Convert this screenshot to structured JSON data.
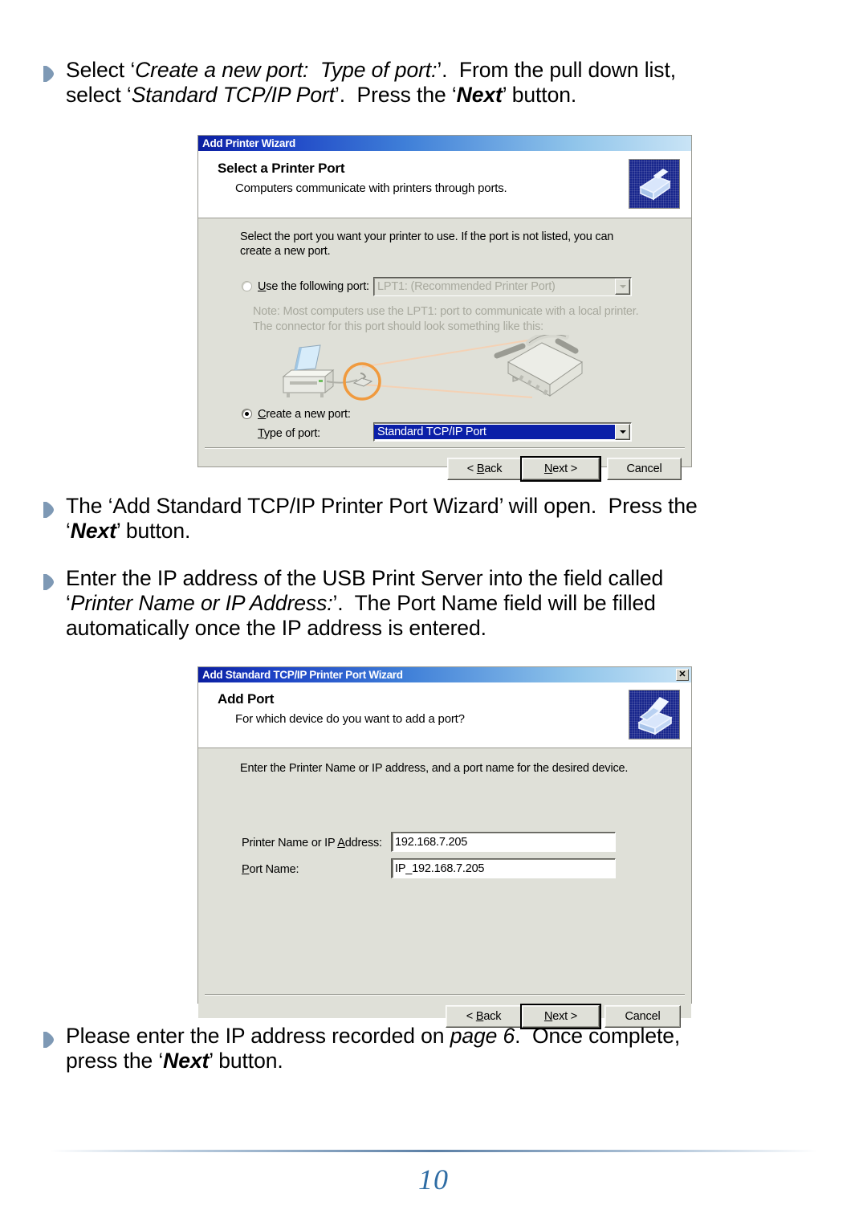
{
  "page": {
    "number": "10"
  },
  "instructions": [
    {
      "id": "step-select-create-new-port",
      "parts": [
        {
          "t": "Select ‘",
          "s": "n"
        },
        {
          "t": "Create a new port:  Type of port:",
          "s": "i"
        },
        {
          "t": "’.  From the pull down list, select ‘",
          "s": "n"
        },
        {
          "t": "Standard TCP/IP Port",
          "s": "i"
        },
        {
          "t": "’.  Press the ‘",
          "s": "n"
        },
        {
          "t": "Next",
          "s": "bi"
        },
        {
          "t": "’ button.",
          "s": "n"
        }
      ]
    },
    {
      "id": "step-wizard-opens",
      "parts": [
        {
          "t": "The ‘Add Standard TCP/IP Printer Port Wizard’ will open.  Press the ‘",
          "s": "n"
        },
        {
          "t": "Next",
          "s": "bi"
        },
        {
          "t": "’ button.",
          "s": "n"
        }
      ]
    },
    {
      "id": "step-enter-ip-address",
      "parts": [
        {
          "t": "Enter the IP address of the USB Print Server into the field called ‘",
          "s": "n"
        },
        {
          "t": "Printer Name or IP Address:",
          "s": "i"
        },
        {
          "t": "’.  The Port Name field will be filled automatically once the IP address is entered.",
          "s": "n"
        }
      ]
    },
    {
      "id": "step-enter-recorded-ip",
      "parts": [
        {
          "t": "Please enter the IP address recorded on ",
          "s": "n"
        },
        {
          "t": "page 6",
          "s": "i"
        },
        {
          "t": ".  Once complete, press the ‘",
          "s": "n"
        },
        {
          "t": "Next",
          "s": "bi"
        },
        {
          "t": "’ button.",
          "s": "n"
        }
      ]
    }
  ],
  "dialog_select_port": {
    "title": "Add Printer Wizard",
    "header_title": "Select a Printer Port",
    "header_subtitle": "Computers communicate with printers through ports.",
    "header_icon": "printer-port-icon",
    "intro": "Select the port you want your printer to use.  If the port is not listed, you can create a new port.",
    "use_following_port": {
      "label_pre": "U",
      "label_post": "se the following port:",
      "selected": false,
      "combo_value": "LPT1: (Recommended Printer Port)",
      "disabled": true
    },
    "note": "Note: Most computers use the LPT1: port to communicate with a local printer. The connector for this port should look something like this:",
    "illustration": "printer-and-parallel-connector-illustration",
    "create_new_port": {
      "label_pre": "C",
      "label_post": "reate a new port:",
      "selected": true,
      "type_label_pre": "T",
      "type_label_post": "ype of port:",
      "combo_value": "Standard TCP/IP Port"
    },
    "buttons": {
      "back": {
        "pre": "< ",
        "key": "B",
        "post": "ack"
      },
      "next": {
        "pre": "",
        "key": "N",
        "post": "ext >"
      },
      "cancel": {
        "pre": "",
        "key": "",
        "post": "Cancel"
      }
    }
  },
  "dialog_add_port": {
    "title": "Add Standard TCP/IP Printer Port Wizard",
    "close_label": "✕",
    "header_title": "Add Port",
    "header_subtitle": "For which device do you want to add a port?",
    "header_icon": "printer-port-icon",
    "intro": "Enter the Printer Name or IP address, and a port name for the desired device.",
    "fields": [
      {
        "name": "printer-name-or-ip-address",
        "label_pre": "Printer Name or IP ",
        "label_key": "A",
        "label_post": "ddress:",
        "value": "192.168.7.205"
      },
      {
        "name": "port-name",
        "label_pre": "",
        "label_key": "P",
        "label_post": "ort Name:",
        "value": "IP_192.168.7.205"
      }
    ],
    "buttons": {
      "back": {
        "pre": "< ",
        "key": "B",
        "post": "ack"
      },
      "next": {
        "pre": "",
        "key": "N",
        "post": "ext >"
      },
      "cancel": {
        "pre": "",
        "key": "",
        "post": "Cancel"
      }
    }
  },
  "colors": {
    "titlebar_start": "#0b1ea0",
    "titlebar_end": "#c9e4f6",
    "dialog_face": "#dfe0d8",
    "selection_blue": "#0a1fa8",
    "page_number": "#2e6ca4",
    "bullet": "#7e99b5"
  }
}
